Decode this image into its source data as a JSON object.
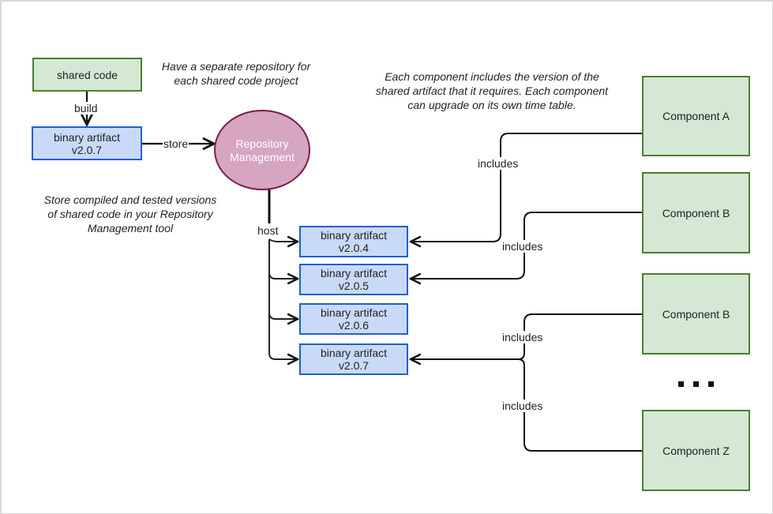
{
  "diagram": {
    "shared_code": {
      "label": "shared code"
    },
    "build_label": "build",
    "built_artifact": {
      "line1": "binary artifact",
      "line2": "v2.0.7"
    },
    "store_label": "store",
    "repository": {
      "line1": "Repository",
      "line2": "Management"
    },
    "host_label": "host",
    "notes": {
      "separate_repo": [
        "Have a separate repository for",
        "each shared code project"
      ],
      "store_compiled": [
        "Store compiled and tested versions",
        "of shared code in your Repository",
        "Management tool"
      ],
      "component_includes": [
        "Each component includes the version of the",
        "shared artifact that it requires. Each component",
        "can upgrade on its own time table."
      ]
    },
    "hosted_artifacts": [
      {
        "line1": "binary artifact",
        "line2": "v2.0.4"
      },
      {
        "line1": "binary artifact",
        "line2": "v2.0.5"
      },
      {
        "line1": "binary artifact",
        "line2": "v2.0.6"
      },
      {
        "line1": "binary artifact",
        "line2": "v2.0.7"
      }
    ],
    "components": [
      {
        "label": "Component A"
      },
      {
        "label": "Component B"
      },
      {
        "label": "Component B"
      },
      {
        "label": "Component Z"
      }
    ],
    "edge_labels": [
      "includes",
      "includes",
      "includes",
      "includes"
    ],
    "colors": {
      "component_fill": "#d5e8d4",
      "component_stroke": "#4a7f2f",
      "artifact_fill": "#c9daf8",
      "artifact_stroke": "#1f5fd0",
      "repository_fill": "#d6a5c1",
      "repository_stroke": "#7a1f4a"
    }
  }
}
